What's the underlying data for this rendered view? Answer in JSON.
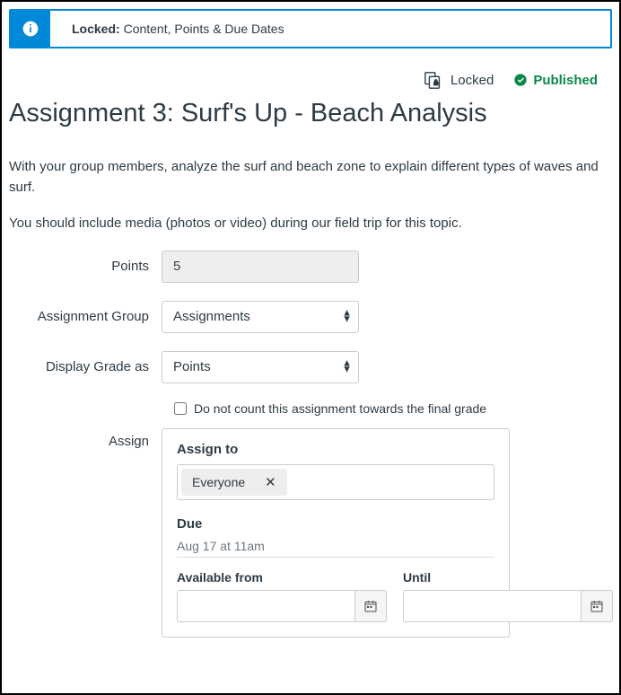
{
  "banner": {
    "locked_prefix": "Locked:",
    "locked_text": " Content, Points & Due Dates"
  },
  "status": {
    "locked_label": "Locked",
    "published_label": "Published"
  },
  "title": "Assignment 3: Surf's Up - Beach Analysis",
  "description": {
    "p1": "With your group members, analyze the surf and beach zone to explain different types of waves and surf.",
    "p2": "You should include media (photos or video) during our field trip for this topic."
  },
  "form": {
    "points_label": "Points",
    "points_value": "5",
    "group_label": "Assignment Group",
    "group_value": "Assignments",
    "display_label": "Display Grade as",
    "display_value": "Points",
    "checkbox_label": "Do not count this assignment towards the final grade"
  },
  "assign": {
    "label": "Assign",
    "assign_to_label": "Assign to",
    "chip": "Everyone",
    "due_label": "Due",
    "due_value": "Aug 17 at 11am",
    "available_from_label": "Available from",
    "until_label": "Until",
    "available_from_value": "",
    "until_value": ""
  }
}
